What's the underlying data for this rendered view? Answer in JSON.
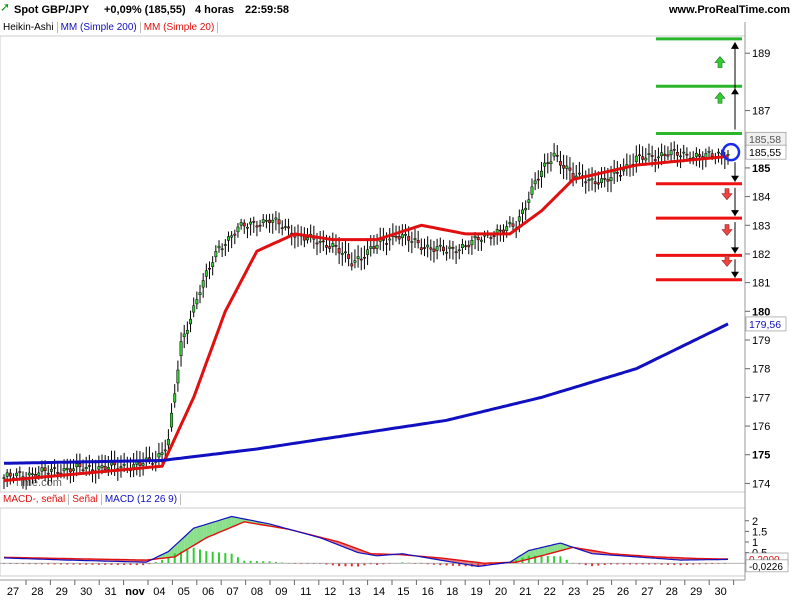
{
  "header": {
    "instrument": "Spot GBP/JPY",
    "change": "+0,09% (185,55)",
    "timeframe": "4 horas",
    "time": "22:59:58",
    "site": "www.ProRealTime.com"
  },
  "watermark": "Time.com",
  "indicators": {
    "main_legend": [
      "Heikin-Ashi",
      "MM (Simple 200)",
      "MM (Simple 20)"
    ],
    "main_colors": [
      "#000000",
      "#1010c0",
      "#e01010"
    ],
    "macd_legend": [
      "MACD-, señal",
      "Señal",
      "MACD (12 26 9)"
    ],
    "macd_colors": [
      "#e01010",
      "#e01010",
      "#1010c0"
    ]
  },
  "badges": {
    "last_price": "185,55",
    "sma200": "179,56",
    "hidden_price": "185,58",
    "macd_signal": "0,2000",
    "macd_hist": "-0,0226"
  },
  "chart_data": [
    {
      "type": "candlestick",
      "title": "Spot GBP/JPY",
      "ylim": [
        173.7,
        189.6
      ],
      "ticks_y": [
        "174",
        "175",
        "176",
        "177",
        "178",
        "179",
        "180",
        "181",
        "182",
        "183",
        "184",
        "185",
        "187",
        "189"
      ],
      "x_labels": [
        "27",
        "28",
        "29",
        "30",
        "31",
        "nov",
        "04",
        "05",
        "06",
        "07",
        "08",
        "09",
        "11",
        "12",
        "13",
        "14",
        "15",
        "16",
        "18",
        "19",
        "20",
        "21",
        "22",
        "23",
        "25",
        "26",
        "27",
        "28",
        "29",
        "30"
      ],
      "candle_count": 230,
      "price_path": [
        [
          0,
          174.2
        ],
        [
          20,
          174.5
        ],
        [
          40,
          174.6
        ],
        [
          48,
          174.8
        ],
        [
          52,
          175.5
        ],
        [
          56,
          178.8
        ],
        [
          62,
          180.8
        ],
        [
          68,
          182.2
        ],
        [
          74,
          182.9
        ],
        [
          84,
          183.2
        ],
        [
          94,
          182.6
        ],
        [
          104,
          182.3
        ],
        [
          110,
          181.7
        ],
        [
          118,
          182.3
        ],
        [
          124,
          182.7
        ],
        [
          132,
          182.3
        ],
        [
          140,
          182.1
        ],
        [
          146,
          182.3
        ],
        [
          154,
          182.7
        ],
        [
          162,
          183.0
        ],
        [
          168,
          184.5
        ],
        [
          174,
          185.5
        ],
        [
          180,
          184.7
        ],
        [
          190,
          184.5
        ],
        [
          200,
          185.3
        ],
        [
          210,
          185.5
        ],
        [
          222,
          185.4
        ],
        [
          229,
          185.55
        ]
      ],
      "series": [
        {
          "name": "MM (Simple 20)",
          "color": "#e01010",
          "points": [
            [
              0,
              174.1
            ],
            [
              50,
              174.6
            ],
            [
              60,
              177.0
            ],
            [
              70,
              180.0
            ],
            [
              80,
              182.1
            ],
            [
              92,
              182.7
            ],
            [
              104,
              182.5
            ],
            [
              118,
              182.5
            ],
            [
              132,
              183.0
            ],
            [
              146,
              182.7
            ],
            [
              160,
              182.7
            ],
            [
              170,
              183.5
            ],
            [
              180,
              184.6
            ],
            [
              200,
              185.1
            ],
            [
              229,
              185.4
            ]
          ]
        },
        {
          "name": "MM (Simple 200)",
          "color": "#1010c0",
          "points": [
            [
              0,
              174.7
            ],
            [
              50,
              174.8
            ],
            [
              80,
              175.2
            ],
            [
              110,
              175.7
            ],
            [
              140,
              176.2
            ],
            [
              170,
              177.0
            ],
            [
              200,
              178.0
            ],
            [
              229,
              179.56
            ]
          ]
        }
      ],
      "green_levels": [
        189.5,
        187.85,
        186.2
      ],
      "red_levels": [
        184.45,
        183.25,
        181.95,
        181.1
      ],
      "last_price": 185.55,
      "sma200_last": 179.56
    },
    {
      "type": "bar",
      "title": "MACD (12 26 9)",
      "ylim": [
        -0.6,
        2.6
      ],
      "ticks_y": [
        "2",
        "1.5",
        "1",
        "0.5"
      ],
      "macd_path": [
        [
          0,
          0.25
        ],
        [
          20,
          0.15
        ],
        [
          45,
          0.05
        ],
        [
          52,
          0.55
        ],
        [
          60,
          1.65
        ],
        [
          72,
          2.2
        ],
        [
          84,
          1.85
        ],
        [
          100,
          1.2
        ],
        [
          112,
          0.5
        ],
        [
          118,
          0.35
        ],
        [
          126,
          0.45
        ],
        [
          136,
          0.2
        ],
        [
          150,
          -0.15
        ],
        [
          160,
          0.05
        ],
        [
          166,
          0.6
        ],
        [
          176,
          0.95
        ],
        [
          186,
          0.45
        ],
        [
          200,
          0.3
        ],
        [
          214,
          0.15
        ],
        [
          229,
          0.18
        ]
      ],
      "signal_path": [
        [
          0,
          0.28
        ],
        [
          20,
          0.22
        ],
        [
          45,
          0.15
        ],
        [
          54,
          0.3
        ],
        [
          64,
          1.2
        ],
        [
          76,
          1.95
        ],
        [
          90,
          1.6
        ],
        [
          106,
          1.0
        ],
        [
          116,
          0.45
        ],
        [
          126,
          0.4
        ],
        [
          138,
          0.25
        ],
        [
          152,
          0.0
        ],
        [
          162,
          0.05
        ],
        [
          170,
          0.35
        ],
        [
          180,
          0.75
        ],
        [
          192,
          0.45
        ],
        [
          206,
          0.3
        ],
        [
          220,
          0.22
        ],
        [
          229,
          0.2
        ]
      ],
      "last_signal": 0.2,
      "last_hist": -0.0226
    }
  ]
}
